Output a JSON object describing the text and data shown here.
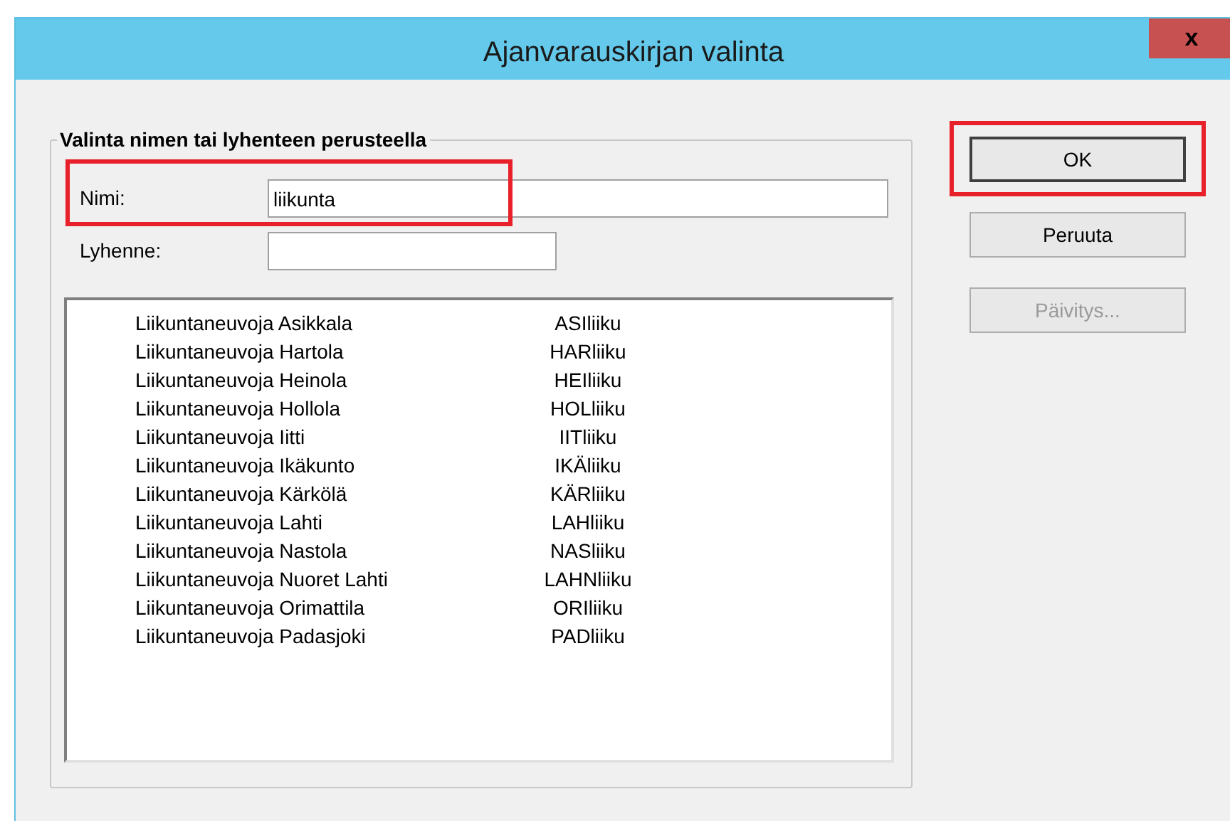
{
  "window": {
    "title": "Ajanvarauskirjan valinta",
    "close": "x"
  },
  "group": {
    "title": "Valinta nimen tai lyhenteen perusteella",
    "fields": [
      {
        "label": "Nimi:",
        "value": "liikunta",
        "highlighted": true
      },
      {
        "label": "Lyhenne:",
        "highlighted": false
      }
    ]
  },
  "list": [
    {
      "name": "Liikuntaneuvoja Asikkala",
      "code": "ASIliiku"
    },
    {
      "name": "Liikuntaneuvoja Hartola",
      "code": "HARliiku"
    },
    {
      "name": "Liikuntaneuvoja Heinola",
      "code": "HEIliiku"
    },
    {
      "name": "Liikuntaneuvoja Hollola",
      "code": "HOLliiku"
    },
    {
      "name": "Liikuntaneuvoja Iitti",
      "code": "IITliiku"
    },
    {
      "name": "Liikuntaneuvoja Ikäkunto",
      "code": "IKÄliiku"
    },
    {
      "name": "Liikuntaneuvoja Kärkölä",
      "code": "KÄRliiku"
    },
    {
      "name": "Liikuntaneuvoja Lahti",
      "code": "LAHliiku"
    },
    {
      "name": "Liikuntaneuvoja Nastola",
      "code": "NASliiku"
    },
    {
      "name": "Liikuntaneuvoja Nuoret Lahti",
      "code": "LAHNliiku"
    },
    {
      "name": "Liikuntaneuvoja Orimattila",
      "code": "ORIliiku"
    },
    {
      "name": "Liikuntaneuvoja Padasjoki",
      "code": "PADliiku"
    }
  ],
  "buttons": [
    {
      "label": "OK",
      "disabled": false,
      "highlighted": true
    },
    {
      "label": "Peruuta",
      "disabled": false,
      "highlighted": false
    },
    {
      "label": "Päivitys...",
      "disabled": true,
      "highlighted": false
    }
  ]
}
